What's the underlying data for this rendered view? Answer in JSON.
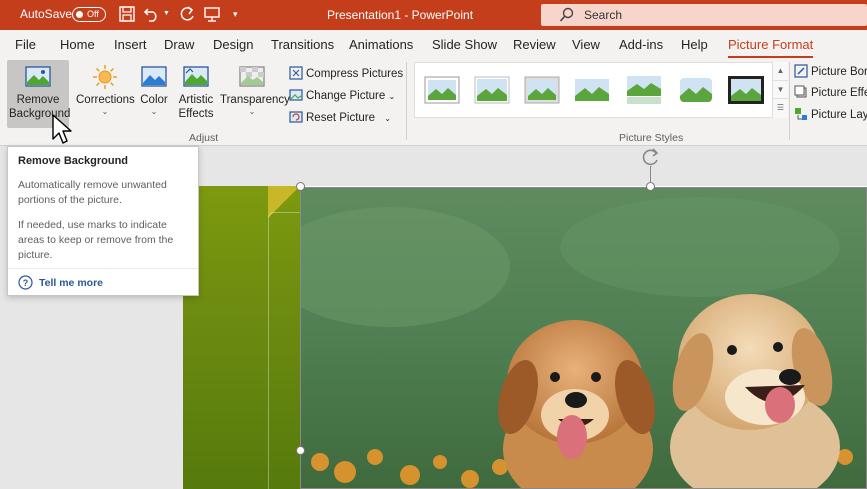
{
  "titlebar": {
    "autosave_label": "AutoSave",
    "autosave_state": "Off",
    "document_title": "Presentation1 - PowerPoint",
    "search_placeholder": "Search",
    "quick_access_icons": [
      "save-icon",
      "undo-icon",
      "redo-icon",
      "present-icon",
      "customize-icon"
    ],
    "brand_color": "#c43e1c"
  },
  "tabs": [
    {
      "label": "File"
    },
    {
      "label": "Home"
    },
    {
      "label": "Insert"
    },
    {
      "label": "Draw"
    },
    {
      "label": "Design"
    },
    {
      "label": "Transitions"
    },
    {
      "label": "Animations"
    },
    {
      "label": "Slide Show"
    },
    {
      "label": "Review"
    },
    {
      "label": "View"
    },
    {
      "label": "Add-ins"
    },
    {
      "label": "Help"
    },
    {
      "label": "Picture Format",
      "active": true
    }
  ],
  "ribbon": {
    "remove_background": "Remove Background",
    "corrections": "Corrections",
    "color": "Color",
    "artistic_effects": "Artistic Effects",
    "transparency": "Transparency",
    "compress_pictures": "Compress Pictures",
    "change_picture": "Change Picture",
    "reset_picture": "Reset Picture",
    "adjust_group": "Adjust",
    "picture_styles_group": "Picture Styles",
    "picture_border": "Picture Bord",
    "picture_effects": "Picture Effe",
    "picture_layout": "Picture Layo"
  },
  "tooltip": {
    "title": "Remove Background",
    "text1": "Automatically remove unwanted portions of the picture.",
    "text2": "If needed, use marks to indicate areas to keep or remove from the picture.",
    "link": "Tell me more"
  }
}
